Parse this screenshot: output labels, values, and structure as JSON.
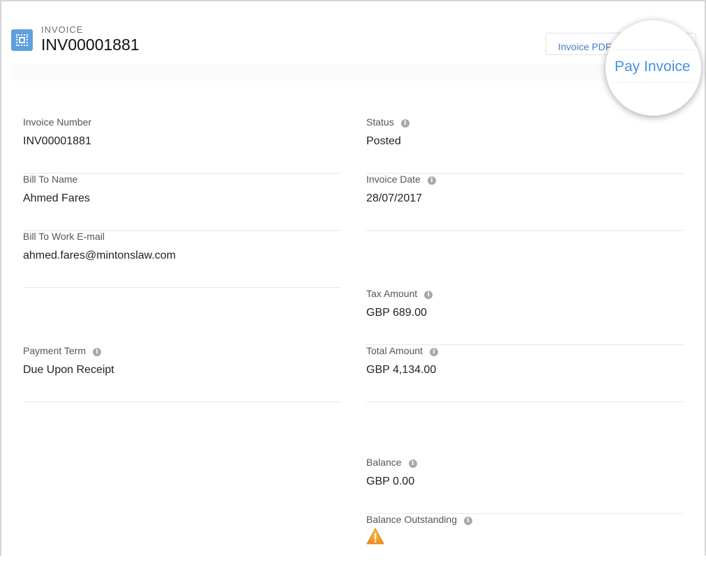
{
  "header": {
    "kicker": "INVOICE",
    "title": "INV00001881",
    "icon": "invoice-icon"
  },
  "actions": {
    "pdf": "Invoice PDF",
    "pay": "Pay Invoice"
  },
  "left": [
    {
      "label": "Invoice Number",
      "value": "INV00001881",
      "info": false
    },
    {
      "label": "Bill To Name",
      "value": "Ahmed Fares",
      "info": false
    },
    {
      "label": "Bill To Work E-mail",
      "value": "ahmed.fares@mintonslaw.com",
      "info": false
    },
    {
      "label": "Payment Term",
      "value": "Due Upon Receipt",
      "info": true
    }
  ],
  "right": [
    {
      "label": "Status",
      "value": "Posted",
      "info": true
    },
    {
      "label": "Invoice Date",
      "value": "28/07/2017",
      "info": true
    },
    {
      "label": "Tax Amount",
      "value": "GBP 689.00",
      "info": true
    },
    {
      "label": "Total Amount",
      "value": "GBP 4,134.00",
      "info": true
    },
    {
      "label": "Balance",
      "value": "GBP 0.00",
      "info": true
    },
    {
      "label": "Balance Outstanding",
      "value": "",
      "info": true,
      "icon": "warning-icon"
    }
  ],
  "colors": {
    "accent": "#4a8fe0",
    "icon_bg": "#5e9fe0",
    "warning": "#f5a623"
  }
}
